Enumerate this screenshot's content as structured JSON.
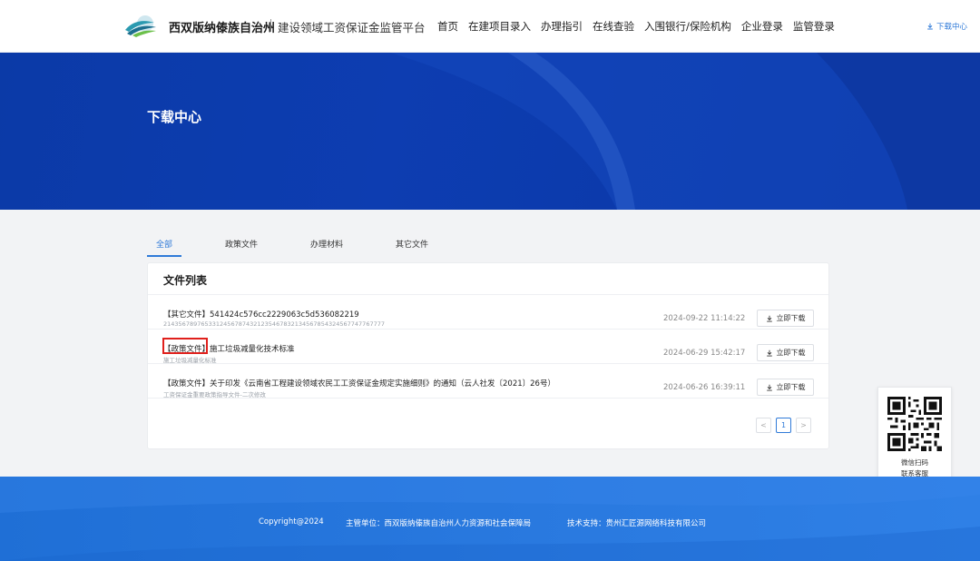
{
  "header": {
    "org_name": "西双版纳傣族自治州",
    "platform_name": "建设领域工资保证金监管平台",
    "nav": [
      "首页",
      "在建项目录入",
      "办理指引",
      "在线查验",
      "入围银行/保险机构",
      "企业登录",
      "监管登录"
    ],
    "download_center": "下载中心"
  },
  "banner": {
    "title": "下载中心"
  },
  "tabs": [
    {
      "label": "全部",
      "active": true
    },
    {
      "label": "政策文件",
      "active": false
    },
    {
      "label": "办理材料",
      "active": false
    },
    {
      "label": "其它文件",
      "active": false
    }
  ],
  "panel": {
    "title": "文件列表"
  },
  "files": [
    {
      "title": "【其它文件】541424c576cc2229063c5d536082219",
      "subtitle": "21435678976533124567874321235467832134567854324567747767777",
      "date": "2024-09-22 11:14:22",
      "button": "立即下载"
    },
    {
      "title": "【政策文件】施工垃圾减量化技术标准",
      "subtitle": "施工垃圾减量化标准",
      "date": "2024-06-29 15:42:17",
      "button": "立即下载"
    },
    {
      "title": "【政策文件】关于印发《云南省工程建设领域农民工工资保证金规定实施细则》的通知（云人社发〔2021〕26号）",
      "subtitle": "工资保证金重要政策指导文件-二次修改",
      "date": "2024-06-26 16:39:11",
      "button": "立即下载"
    }
  ],
  "pagination": {
    "prev": "<",
    "current": "1",
    "next": ">"
  },
  "qr": {
    "line1": "微信扫码",
    "line2": "联系客服"
  },
  "footer": {
    "copyright": "Copyright@2024",
    "sponsor": "主管单位：西双版纳傣族自治州人力资源和社会保障局",
    "support": "技术支持：贵州汇匠源网络科技有限公司"
  },
  "colors": {
    "primary": "#2f7ad8",
    "banner": "#0b3aa7",
    "highlight": "#e0201c"
  }
}
